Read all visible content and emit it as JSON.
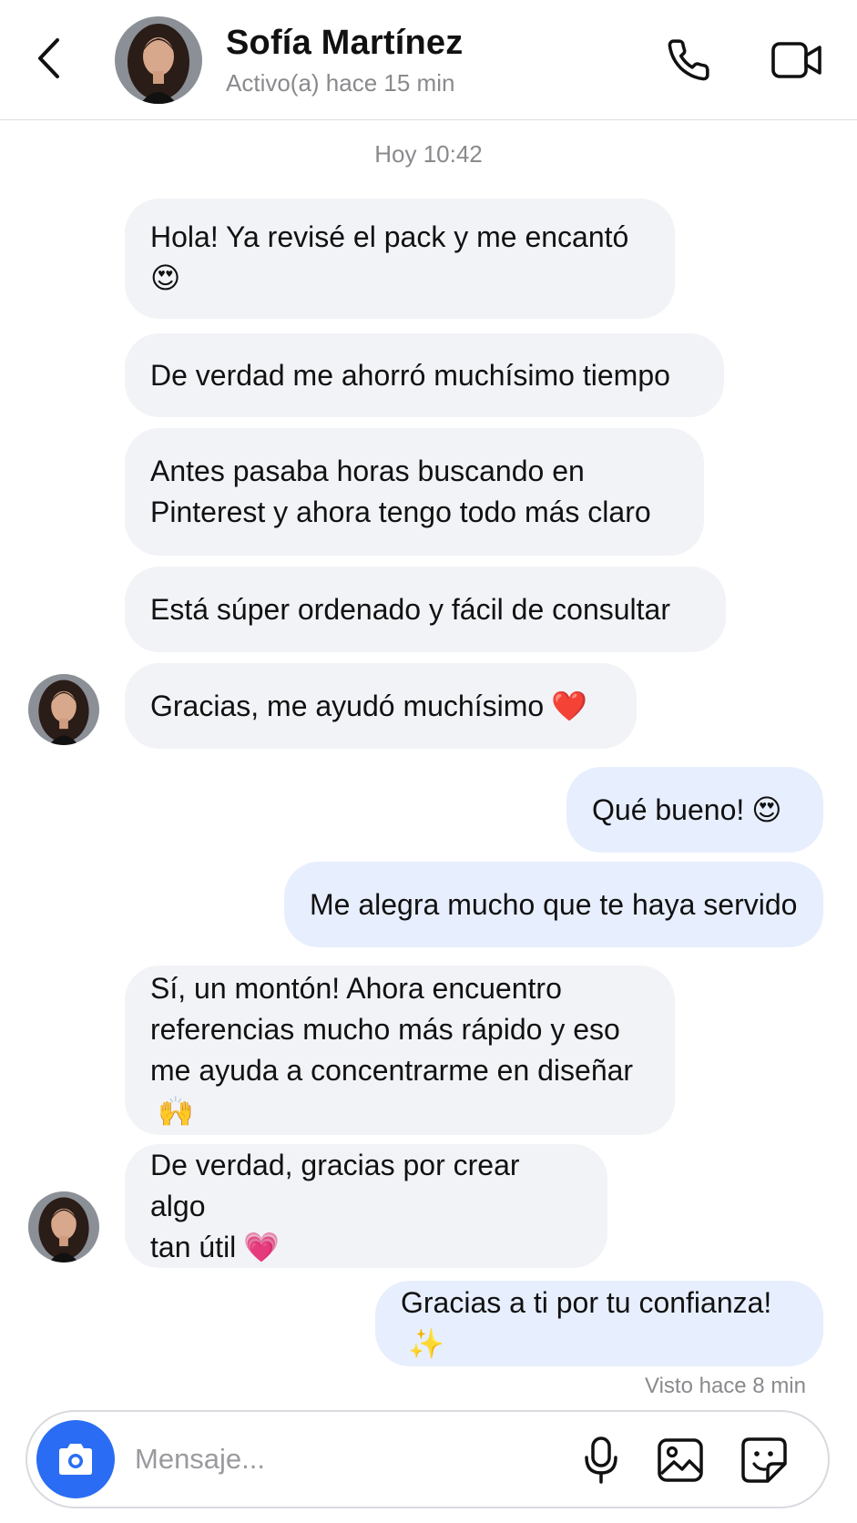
{
  "header": {
    "contact_name": "Sofía Martínez",
    "status": "Activo(a) hace 15 min",
    "back_icon": "chevron-left-icon",
    "call_icon": "phone-icon",
    "video_icon": "video-camera-icon"
  },
  "chat": {
    "timestamp": "Hoy 10:42",
    "messages": [
      {
        "text": "Hola! Ya revisé el pack y me encantó",
        "emoji": "😍"
      },
      {
        "text": "De verdad me ahorró muchísimo tiempo",
        "emoji": ""
      },
      {
        "text": "Antes pasaba horas buscando en\nPinterest y ahora tengo todo más claro",
        "emoji": ""
      },
      {
        "text": "Está súper ordenado y fácil de consultar",
        "emoji": ""
      },
      {
        "text": "Gracias, me ayudó muchísimo",
        "emoji": "❤️"
      },
      {
        "text": "Qué bueno!",
        "emoji": "😍"
      },
      {
        "text": "Me alegra mucho que te haya servido",
        "emoji": ""
      },
      {
        "text": "Sí, un montón! Ahora encuentro\nreferencias mucho más rápido y eso\nme ayuda a concentrarme en diseñar",
        "emoji": "🙌"
      },
      {
        "text": "De verdad, gracias por crear algo\ntan útil",
        "emoji": "💗"
      },
      {
        "text": "Gracias a ti por tu confianza!",
        "emoji": "✨"
      }
    ],
    "seen_status": "Visto hace 8 min"
  },
  "composer": {
    "placeholder": "Mensaje...",
    "camera_icon": "camera-icon",
    "mic_icon": "microphone-icon",
    "image_icon": "image-icon",
    "sticker_icon": "sticker-icon"
  },
  "colors": {
    "incoming_bubble": "#f2f3f7",
    "outgoing_bubble": "#e7eefd",
    "accent": "#2a6df4",
    "muted_text": "#8a8a8e"
  }
}
